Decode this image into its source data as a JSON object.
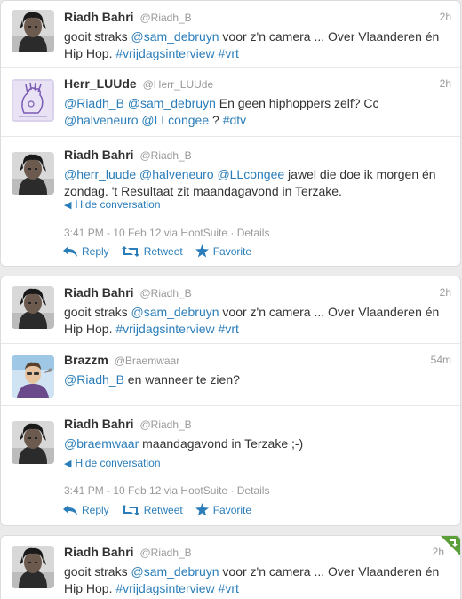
{
  "conversation_1": {
    "tweet_1": {
      "name": "Riadh Bahri",
      "handle": "@Riadh_B",
      "time": "2h",
      "text_1": "gooit straks ",
      "mention_1": "@sam_debruyn",
      "text_2": " voor z'n camera ... Over Vlaanderen én Hip Hop. ",
      "hashtag_1": "#vrijdagsinterview",
      "text_3": " ",
      "hashtag_2": "#vrt"
    },
    "tweet_2": {
      "name": "Herr_LUUde",
      "handle": "@Herr_LUUde",
      "time": "2h",
      "mention_1": "@Riadh_B",
      "text_1": " ",
      "mention_2": "@sam_debruyn",
      "text_2": " En geen hiphoppers zelf? Cc ",
      "mention_3": "@halveneuro",
      "text_3": " ",
      "mention_4": "@LLcongee",
      "text_4": " ? ",
      "hashtag_1": "#dtv"
    },
    "tweet_3": {
      "name": "Riadh Bahri",
      "handle": "@Riadh_B",
      "mention_1": "@herr_luude",
      "text_1": " ",
      "mention_2": "@halveneuro",
      "text_2": " ",
      "mention_3": "@LLcongee",
      "text_3": " jawel die doe ik morgen én zondag. 't Resultaat zit maandagavond in Terzake.",
      "hide_conversation": "Hide conversation",
      "meta": "3:41 PM - 10 Feb 12 via HootSuite · Details",
      "reply": "Reply",
      "retweet": "Retweet",
      "favorite": "Favorite"
    }
  },
  "conversation_2": {
    "tweet_1": {
      "name": "Riadh Bahri",
      "handle": "@Riadh_B",
      "time": "2h",
      "text_1": "gooit straks ",
      "mention_1": "@sam_debruyn",
      "text_2": " voor z'n camera ... Over Vlaanderen én Hip Hop. ",
      "hashtag_1": "#vrijdagsinterview",
      "text_3": " ",
      "hashtag_2": "#vrt"
    },
    "tweet_2": {
      "name": "Brazzm",
      "handle": "@Braemwaar",
      "time": "54m",
      "mention_1": "@Riadh_B",
      "text_1": " en wanneer te zien?"
    },
    "tweet_3": {
      "name": "Riadh Bahri",
      "handle": "@Riadh_B",
      "mention_1": "@braemwaar",
      "text_1": " maandagavond in Terzake ;-)",
      "hide_conversation": "Hide conversation",
      "meta": "3:41 PM - 10 Feb 12 via HootSuite · Details",
      "reply": "Reply",
      "retweet": "Retweet",
      "favorite": "Favorite"
    }
  },
  "standalone": {
    "name": "Riadh Bahri",
    "handle": "@Riadh_B",
    "time": "2h",
    "text_1": "gooit straks ",
    "mention_1": "@sam_debruyn",
    "text_2": " voor z'n camera ... Over Vlaanderen én Hip Hop. ",
    "hashtag_1": "#vrijdagsinterview",
    "text_3": " ",
    "hashtag_2": "#vrt"
  },
  "colors": {
    "link": "#2a7db9",
    "retweet_corner": "#5c9e3a"
  }
}
